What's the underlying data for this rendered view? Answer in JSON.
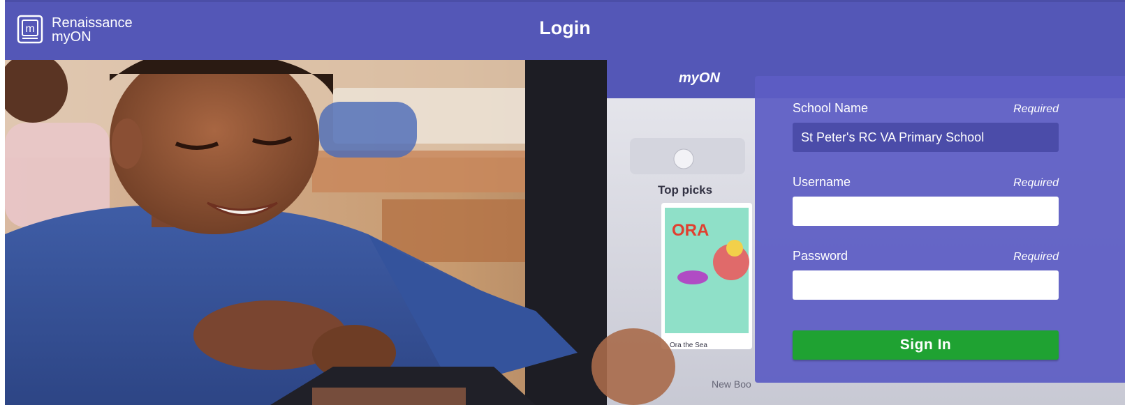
{
  "brand": {
    "line1": "Renaissance",
    "line2": "myON",
    "logo_icon": "book-m-icon"
  },
  "header": {
    "title": "Login",
    "background_color": "#5457b7"
  },
  "hero": {
    "tablet_logo": "myON",
    "tablet_section": "Top picks",
    "tablet_section_2": "New Boo",
    "book_title": "ORA",
    "book_caption": "Ora the Sea"
  },
  "login_form": {
    "school_name": {
      "label": "School Name",
      "required": "Required",
      "value": "St Peter's RC VA Primary School"
    },
    "username": {
      "label": "Username",
      "required": "Required",
      "value": ""
    },
    "password": {
      "label": "Password",
      "required": "Required",
      "value": ""
    },
    "submit_label": "Sign In",
    "submit_color": "#1fa232",
    "panel_color": "#5c5dc4"
  }
}
